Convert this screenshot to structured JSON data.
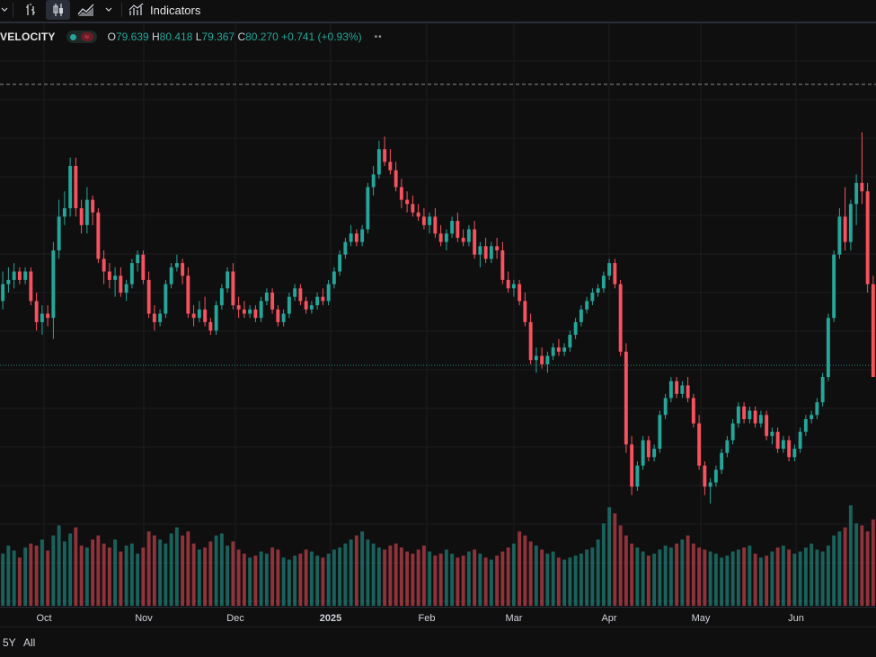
{
  "toolbar": {
    "indicators_label": "Indicators",
    "icons": [
      "chevron-down-icon",
      "bar-chart-icon",
      "candlestick-icon",
      "area-chart-icon",
      "chevron-down-icon",
      "indicators-icon"
    ]
  },
  "legend": {
    "symbol": "VELOCITY",
    "status_badge": "≈",
    "open_key": "O",
    "open": "79.639",
    "high_key": "H",
    "high": "80.418",
    "low_key": "L",
    "low": "79.367",
    "close_key": "C",
    "close": "80.270",
    "change": "+0.741 (+0.93%)",
    "more": "••"
  },
  "colors": {
    "up": "#26a69a",
    "down": "#f7525f",
    "background": "#0f0f0f",
    "grid": "#1c1e22"
  },
  "time_axis": {
    "labels": [
      {
        "text": "Oct",
        "bold": false
      },
      {
        "text": "Nov",
        "bold": false
      },
      {
        "text": "Dec",
        "bold": false
      },
      {
        "text": "2025",
        "bold": true
      },
      {
        "text": "Feb",
        "bold": false
      },
      {
        "text": "Mar",
        "bold": false
      },
      {
        "text": "Apr",
        "bold": false
      },
      {
        "text": "May",
        "bold": false
      },
      {
        "text": "Jun",
        "bold": false
      }
    ]
  },
  "range_buttons": [
    "5Y",
    "All"
  ],
  "chart_data": {
    "type": "candlestick",
    "candles": [
      [
        0.48,
        0.55,
        0.46,
        0.52
      ],
      [
        0.52,
        0.56,
        0.5,
        0.53
      ],
      [
        0.53,
        0.57,
        0.51,
        0.55
      ],
      [
        0.55,
        0.56,
        0.52,
        0.53
      ],
      [
        0.53,
        0.56,
        0.52,
        0.55
      ],
      [
        0.55,
        0.56,
        0.47,
        0.48
      ],
      [
        0.48,
        0.5,
        0.41,
        0.43
      ],
      [
        0.43,
        0.47,
        0.4,
        0.45
      ],
      [
        0.45,
        0.47,
        0.42,
        0.44
      ],
      [
        0.44,
        0.62,
        0.39,
        0.6
      ],
      [
        0.6,
        0.72,
        0.58,
        0.68
      ],
      [
        0.68,
        0.74,
        0.66,
        0.7
      ],
      [
        0.7,
        0.82,
        0.68,
        0.8
      ],
      [
        0.8,
        0.82,
        0.68,
        0.7
      ],
      [
        0.7,
        0.72,
        0.64,
        0.66
      ],
      [
        0.66,
        0.75,
        0.64,
        0.72
      ],
      [
        0.72,
        0.73,
        0.66,
        0.69
      ],
      [
        0.69,
        0.7,
        0.57,
        0.58
      ],
      [
        0.58,
        0.6,
        0.52,
        0.55
      ],
      [
        0.55,
        0.57,
        0.51,
        0.53
      ],
      [
        0.53,
        0.56,
        0.49,
        0.54
      ],
      [
        0.54,
        0.56,
        0.49,
        0.5
      ],
      [
        0.5,
        0.53,
        0.48,
        0.52
      ],
      [
        0.52,
        0.58,
        0.51,
        0.57
      ],
      [
        0.57,
        0.6,
        0.55,
        0.59
      ],
      [
        0.59,
        0.6,
        0.52,
        0.53
      ],
      [
        0.53,
        0.55,
        0.44,
        0.45
      ],
      [
        0.45,
        0.47,
        0.41,
        0.43
      ],
      [
        0.43,
        0.46,
        0.42,
        0.45
      ],
      [
        0.45,
        0.53,
        0.44,
        0.52
      ],
      [
        0.52,
        0.57,
        0.51,
        0.56
      ],
      [
        0.56,
        0.59,
        0.55,
        0.57
      ],
      [
        0.57,
        0.58,
        0.52,
        0.54
      ],
      [
        0.54,
        0.56,
        0.44,
        0.45
      ],
      [
        0.45,
        0.47,
        0.42,
        0.44
      ],
      [
        0.44,
        0.48,
        0.43,
        0.46
      ],
      [
        0.46,
        0.49,
        0.42,
        0.43
      ],
      [
        0.43,
        0.44,
        0.4,
        0.41
      ],
      [
        0.41,
        0.48,
        0.4,
        0.47
      ],
      [
        0.47,
        0.52,
        0.46,
        0.51
      ],
      [
        0.51,
        0.56,
        0.5,
        0.55
      ],
      [
        0.55,
        0.57,
        0.46,
        0.47
      ],
      [
        0.47,
        0.49,
        0.44,
        0.46
      ],
      [
        0.46,
        0.48,
        0.44,
        0.45
      ],
      [
        0.45,
        0.47,
        0.44,
        0.46
      ],
      [
        0.46,
        0.47,
        0.43,
        0.44
      ],
      [
        0.44,
        0.49,
        0.43,
        0.48
      ],
      [
        0.48,
        0.51,
        0.47,
        0.5
      ],
      [
        0.5,
        0.51,
        0.45,
        0.46
      ],
      [
        0.46,
        0.47,
        0.42,
        0.43
      ],
      [
        0.43,
        0.46,
        0.42,
        0.45
      ],
      [
        0.45,
        0.5,
        0.44,
        0.49
      ],
      [
        0.49,
        0.52,
        0.48,
        0.51
      ],
      [
        0.51,
        0.52,
        0.47,
        0.48
      ],
      [
        0.48,
        0.49,
        0.45,
        0.46
      ],
      [
        0.46,
        0.48,
        0.45,
        0.47
      ],
      [
        0.47,
        0.5,
        0.46,
        0.49
      ],
      [
        0.49,
        0.51,
        0.47,
        0.48
      ],
      [
        0.48,
        0.53,
        0.47,
        0.52
      ],
      [
        0.52,
        0.56,
        0.51,
        0.55
      ],
      [
        0.55,
        0.6,
        0.54,
        0.59
      ],
      [
        0.59,
        0.63,
        0.58,
        0.62
      ],
      [
        0.62,
        0.66,
        0.61,
        0.64
      ],
      [
        0.64,
        0.65,
        0.61,
        0.62
      ],
      [
        0.62,
        0.66,
        0.61,
        0.65
      ],
      [
        0.65,
        0.76,
        0.64,
        0.75
      ],
      [
        0.75,
        0.8,
        0.73,
        0.78
      ],
      [
        0.78,
        0.86,
        0.77,
        0.84
      ],
      [
        0.84,
        0.87,
        0.8,
        0.81
      ],
      [
        0.81,
        0.84,
        0.78,
        0.79
      ],
      [
        0.79,
        0.81,
        0.74,
        0.75
      ],
      [
        0.75,
        0.77,
        0.7,
        0.72
      ],
      [
        0.72,
        0.74,
        0.69,
        0.71
      ],
      [
        0.71,
        0.73,
        0.68,
        0.69
      ],
      [
        0.69,
        0.71,
        0.67,
        0.68
      ],
      [
        0.68,
        0.7,
        0.65,
        0.66
      ],
      [
        0.66,
        0.69,
        0.64,
        0.68
      ],
      [
        0.68,
        0.7,
        0.63,
        0.64
      ],
      [
        0.64,
        0.66,
        0.61,
        0.62
      ],
      [
        0.62,
        0.65,
        0.6,
        0.64
      ],
      [
        0.64,
        0.68,
        0.63,
        0.67
      ],
      [
        0.67,
        0.69,
        0.62,
        0.63
      ],
      [
        0.63,
        0.65,
        0.61,
        0.62
      ],
      [
        0.62,
        0.66,
        0.61,
        0.65
      ],
      [
        0.65,
        0.67,
        0.58,
        0.59
      ],
      [
        0.59,
        0.62,
        0.56,
        0.61
      ],
      [
        0.61,
        0.63,
        0.57,
        0.58
      ],
      [
        0.58,
        0.62,
        0.57,
        0.61
      ],
      [
        0.61,
        0.63,
        0.58,
        0.6
      ],
      [
        0.6,
        0.62,
        0.52,
        0.53
      ],
      [
        0.53,
        0.55,
        0.5,
        0.51
      ],
      [
        0.51,
        0.53,
        0.49,
        0.52
      ],
      [
        0.52,
        0.53,
        0.47,
        0.48
      ],
      [
        0.48,
        0.5,
        0.42,
        0.43
      ],
      [
        0.43,
        0.45,
        0.33,
        0.34
      ],
      [
        0.34,
        0.37,
        0.31,
        0.35
      ],
      [
        0.35,
        0.37,
        0.32,
        0.33
      ],
      [
        0.33,
        0.36,
        0.31,
        0.35
      ],
      [
        0.35,
        0.38,
        0.34,
        0.37
      ],
      [
        0.37,
        0.39,
        0.35,
        0.36
      ],
      [
        0.36,
        0.38,
        0.35,
        0.37
      ],
      [
        0.37,
        0.41,
        0.36,
        0.4
      ],
      [
        0.4,
        0.44,
        0.39,
        0.43
      ],
      [
        0.43,
        0.47,
        0.42,
        0.46
      ],
      [
        0.46,
        0.49,
        0.45,
        0.48
      ],
      [
        0.48,
        0.51,
        0.47,
        0.5
      ],
      [
        0.5,
        0.52,
        0.49,
        0.51
      ],
      [
        0.51,
        0.55,
        0.5,
        0.54
      ],
      [
        0.54,
        0.58,
        0.53,
        0.57
      ],
      [
        0.57,
        0.58,
        0.51,
        0.52
      ],
      [
        0.52,
        0.53,
        0.35,
        0.36
      ],
      [
        0.36,
        0.38,
        0.12,
        0.14
      ],
      [
        0.14,
        0.16,
        0.02,
        0.04
      ],
      [
        0.04,
        0.1,
        0.03,
        0.09
      ],
      [
        0.09,
        0.16,
        0.08,
        0.15
      ],
      [
        0.15,
        0.16,
        0.1,
        0.11
      ],
      [
        0.11,
        0.14,
        0.1,
        0.13
      ],
      [
        0.13,
        0.22,
        0.12,
        0.21
      ],
      [
        0.21,
        0.26,
        0.2,
        0.25
      ],
      [
        0.25,
        0.3,
        0.24,
        0.29
      ],
      [
        0.29,
        0.3,
        0.25,
        0.26
      ],
      [
        0.26,
        0.29,
        0.25,
        0.28
      ],
      [
        0.28,
        0.3,
        0.24,
        0.25
      ],
      [
        0.25,
        0.26,
        0.18,
        0.19
      ],
      [
        0.19,
        0.21,
        0.08,
        0.09
      ],
      [
        0.09,
        0.1,
        0.02,
        0.04
      ],
      [
        0.04,
        0.06,
        0.0,
        0.05
      ],
      [
        0.05,
        0.09,
        0.04,
        0.08
      ],
      [
        0.08,
        0.13,
        0.07,
        0.12
      ],
      [
        0.12,
        0.16,
        0.11,
        0.15
      ],
      [
        0.15,
        0.2,
        0.14,
        0.19
      ],
      [
        0.19,
        0.24,
        0.18,
        0.23
      ],
      [
        0.23,
        0.24,
        0.19,
        0.2
      ],
      [
        0.2,
        0.23,
        0.19,
        0.22
      ],
      [
        0.22,
        0.23,
        0.18,
        0.19
      ],
      [
        0.19,
        0.22,
        0.18,
        0.21
      ],
      [
        0.21,
        0.22,
        0.15,
        0.16
      ],
      [
        0.16,
        0.18,
        0.14,
        0.17
      ],
      [
        0.17,
        0.18,
        0.12,
        0.13
      ],
      [
        0.13,
        0.16,
        0.12,
        0.15
      ],
      [
        0.15,
        0.16,
        0.1,
        0.11
      ],
      [
        0.11,
        0.14,
        0.1,
        0.13
      ],
      [
        0.13,
        0.18,
        0.12,
        0.17
      ],
      [
        0.17,
        0.21,
        0.16,
        0.2
      ],
      [
        0.2,
        0.22,
        0.19,
        0.21
      ],
      [
        0.21,
        0.25,
        0.2,
        0.24
      ],
      [
        0.24,
        0.31,
        0.23,
        0.3
      ],
      [
        0.3,
        0.45,
        0.29,
        0.44
      ],
      [
        0.44,
        0.6,
        0.43,
        0.59
      ],
      [
        0.59,
        0.7,
        0.58,
        0.68
      ],
      [
        0.68,
        0.75,
        0.6,
        0.62
      ],
      [
        0.62,
        0.72,
        0.6,
        0.71
      ],
      [
        0.71,
        0.78,
        0.66,
        0.76
      ],
      [
        0.76,
        0.88,
        0.71,
        0.74
      ],
      [
        0.74,
        0.76,
        0.5,
        0.52
      ],
      [
        0.52,
        0.54,
        0.33,
        0.3
      ]
    ],
    "volumes": [
      0.52,
      0.6,
      0.55,
      0.48,
      0.58,
      0.62,
      0.6,
      0.66,
      0.55,
      0.7,
      0.8,
      0.64,
      0.72,
      0.78,
      0.6,
      0.58,
      0.66,
      0.7,
      0.62,
      0.58,
      0.66,
      0.54,
      0.6,
      0.62,
      0.52,
      0.58,
      0.74,
      0.7,
      0.66,
      0.62,
      0.72,
      0.78,
      0.7,
      0.74,
      0.62,
      0.56,
      0.58,
      0.64,
      0.7,
      0.72,
      0.6,
      0.64,
      0.56,
      0.52,
      0.48,
      0.5,
      0.54,
      0.52,
      0.58,
      0.56,
      0.48,
      0.46,
      0.5,
      0.52,
      0.56,
      0.54,
      0.5,
      0.48,
      0.52,
      0.56,
      0.58,
      0.62,
      0.66,
      0.7,
      0.74,
      0.66,
      0.62,
      0.58,
      0.56,
      0.6,
      0.62,
      0.58,
      0.54,
      0.52,
      0.56,
      0.6,
      0.54,
      0.5,
      0.52,
      0.56,
      0.52,
      0.48,
      0.5,
      0.54,
      0.56,
      0.52,
      0.48,
      0.46,
      0.5,
      0.54,
      0.58,
      0.62,
      0.74,
      0.7,
      0.64,
      0.6,
      0.56,
      0.52,
      0.54,
      0.48,
      0.46,
      0.48,
      0.5,
      0.52,
      0.56,
      0.58,
      0.66,
      0.82,
      0.98,
      0.92,
      0.8,
      0.7,
      0.62,
      0.58,
      0.54,
      0.5,
      0.52,
      0.56,
      0.6,
      0.58,
      0.62,
      0.66,
      0.7,
      0.62,
      0.58,
      0.56,
      0.54,
      0.52,
      0.48,
      0.5,
      0.54,
      0.56,
      0.58,
      0.6,
      0.52,
      0.48,
      0.5,
      0.54,
      0.58,
      0.6,
      0.56,
      0.52,
      0.54,
      0.58,
      0.62,
      0.56,
      0.54,
      0.6,
      0.7,
      0.74,
      0.78,
      1.0,
      0.82,
      0.8,
      0.74,
      0.86
    ]
  }
}
